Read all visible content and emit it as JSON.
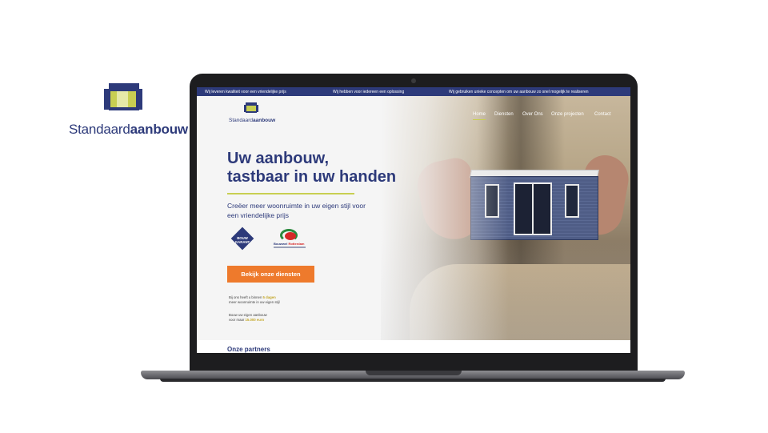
{
  "brand": {
    "name_light": "Standaard",
    "name_bold": "aanbouw",
    "colors": {
      "navy": "#2d3a7a",
      "lime": "#c8cf52",
      "orange": "#ee7a2c"
    }
  },
  "site": {
    "topbar": [
      "Wij leveren kwaliteit voor een vriendelijke prijs",
      "Wij hebben voor iedereen een oplossing",
      "Wij gebruiken unieke concepten om uw aanbouw zo snel mogelijk te realiseren"
    ],
    "logo": {
      "light": "Standaard",
      "bold": "aanbouw"
    },
    "nav": [
      "Home",
      "Diensten",
      "Over Ons",
      "Onze projecten",
      "Contact"
    ],
    "hero": {
      "title_line1": "Uw aanbouw,",
      "title_line2": "tastbaar in uw handen",
      "sub_line1": "Creëer meer woonruimte in uw eigen stijl voor",
      "sub_line2": "een vriendelijke prijs",
      "cta": "Bekijk onze diensten"
    },
    "certs": {
      "bouw_garant_l1": "BOUW",
      "bouw_garant_l2": "GARANT",
      "waarborg_a": "Bouwwel",
      "waarborg_b": "Rotterdam"
    },
    "notes": {
      "n1_line1_a": "Bij ons heeft u binnen",
      "n1_line1_hl": "5 dagen",
      "n1_line2": "meer woonruimte in uw eigen stijl",
      "n2_line1": "Bouw uw eigen aanbouw",
      "n2_line2_a": "voor maar",
      "n2_line2_hl": "15.000 euro"
    },
    "partners_title": "Onze partners"
  },
  "icons": [
    "brand-logo-icon",
    "site-logo-icon",
    "bouw-garant-icon",
    "waarborg-icon",
    "house-model-image"
  ]
}
